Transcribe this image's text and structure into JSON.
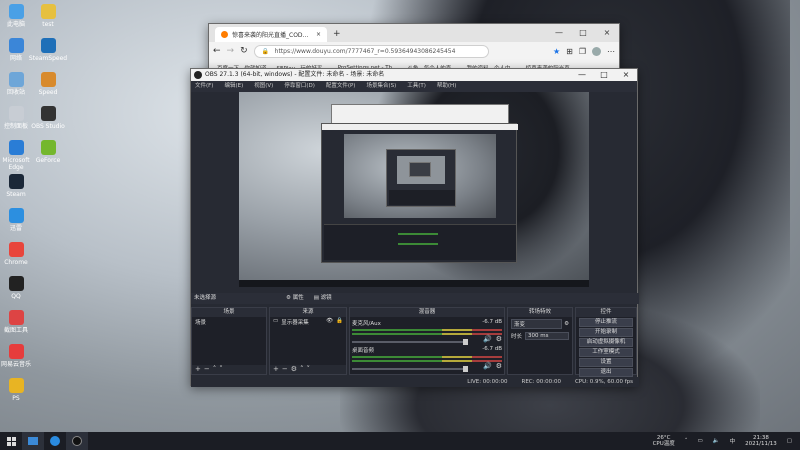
{
  "desktop": {
    "icons": [
      {
        "label": "此电脑",
        "color": "#4aa0e6"
      },
      {
        "label": "test",
        "color": "#e6c040"
      },
      {
        "label": "网络",
        "color": "#3b86d8"
      },
      {
        "label": "SteamSpeed",
        "color": "#1e6fb8"
      },
      {
        "label": "回收站",
        "color": "#6ea6d8"
      },
      {
        "label": "Speed",
        "color": "#d88a2c"
      },
      {
        "label": "控制面板",
        "color": "#c8cdd4"
      },
      {
        "label": "OBS Studio",
        "color": "#333"
      },
      {
        "label": "Microsoft Edge",
        "color": "#2a7dd6"
      },
      {
        "label": "GeForce",
        "color": "#74b72e"
      },
      {
        "label": "Steam",
        "color": "#1b2838"
      },
      {
        "label": "迅雷",
        "color": "#2c8fe0"
      },
      {
        "label": "Chrome",
        "color": "#e8453c"
      },
      {
        "label": "QQ",
        "color": "#222"
      },
      {
        "label": "截图工具",
        "color": "#d44"
      },
      {
        "label": "网易云音乐",
        "color": "#e63c3c"
      },
      {
        "label": "PS",
        "color": "#e8b423"
      }
    ]
  },
  "edge": {
    "tab_title": "惊喜来袭的阳光直播_COD...",
    "tab_close": "×",
    "new_tab": "+",
    "url": "https://www.douyu.com/7777467_r=0.59364943086245454",
    "bookmarks": [
      "百度一下，你就知道",
      "SEPlay - 玩的好平...",
      "ProSettings.net - Th...",
      "斗鱼 - 每个人的直...",
      "我的资料 - 个人中...",
      "惊喜来袭的阳光直..."
    ],
    "window_controls": [
      "—",
      "□",
      "×"
    ]
  },
  "obs": {
    "title": "OBS 27.1.3 (64-bit, windows) - 配置文件: 未命名 - 场景: 未命名",
    "menu": [
      "文件(F)",
      "编辑(E)",
      "视图(V)",
      "停靠窗口(D)",
      "配置文件(P)",
      "场景集合(S)",
      "工具(T)",
      "帮助(H)"
    ],
    "window_controls": [
      "—",
      "□",
      "×"
    ],
    "source_bar": {
      "label": "未选择源",
      "props": "属性",
      "filters": "滤镜"
    },
    "docks": {
      "scenes": {
        "title": "场景",
        "items": [
          "场景"
        ]
      },
      "sources": {
        "title": "来源",
        "items": [
          "显示器采集"
        ]
      },
      "mixer": {
        "title": "混音器",
        "channels": [
          {
            "name": "麦克风/Aux",
            "db": "-6.7 dB"
          },
          {
            "name": "桌面音频",
            "db": "-6.7 dB"
          }
        ]
      },
      "transitions": {
        "title": "转场特效",
        "type": "渐变",
        "duration_label": "时长",
        "duration": "300 ms"
      },
      "controls": {
        "title": "控件",
        "buttons": [
          "停止推流",
          "开始录制",
          "启动虚拟摄像机",
          "工作室模式",
          "设置",
          "退出"
        ]
      }
    },
    "status": {
      "live": "LIVE: 00:00:00",
      "rec": "REC: 00:00:00",
      "cpu": "CPU: 0.9%, 60.00 fps"
    }
  },
  "taskbar": {
    "weather": "26°C",
    "weather_sub": "CPU温度",
    "time": "21:38",
    "date": "2021/11/13"
  },
  "colors": {
    "obs_bg": "#272a33",
    "edge_blue": "#1a73e8"
  }
}
